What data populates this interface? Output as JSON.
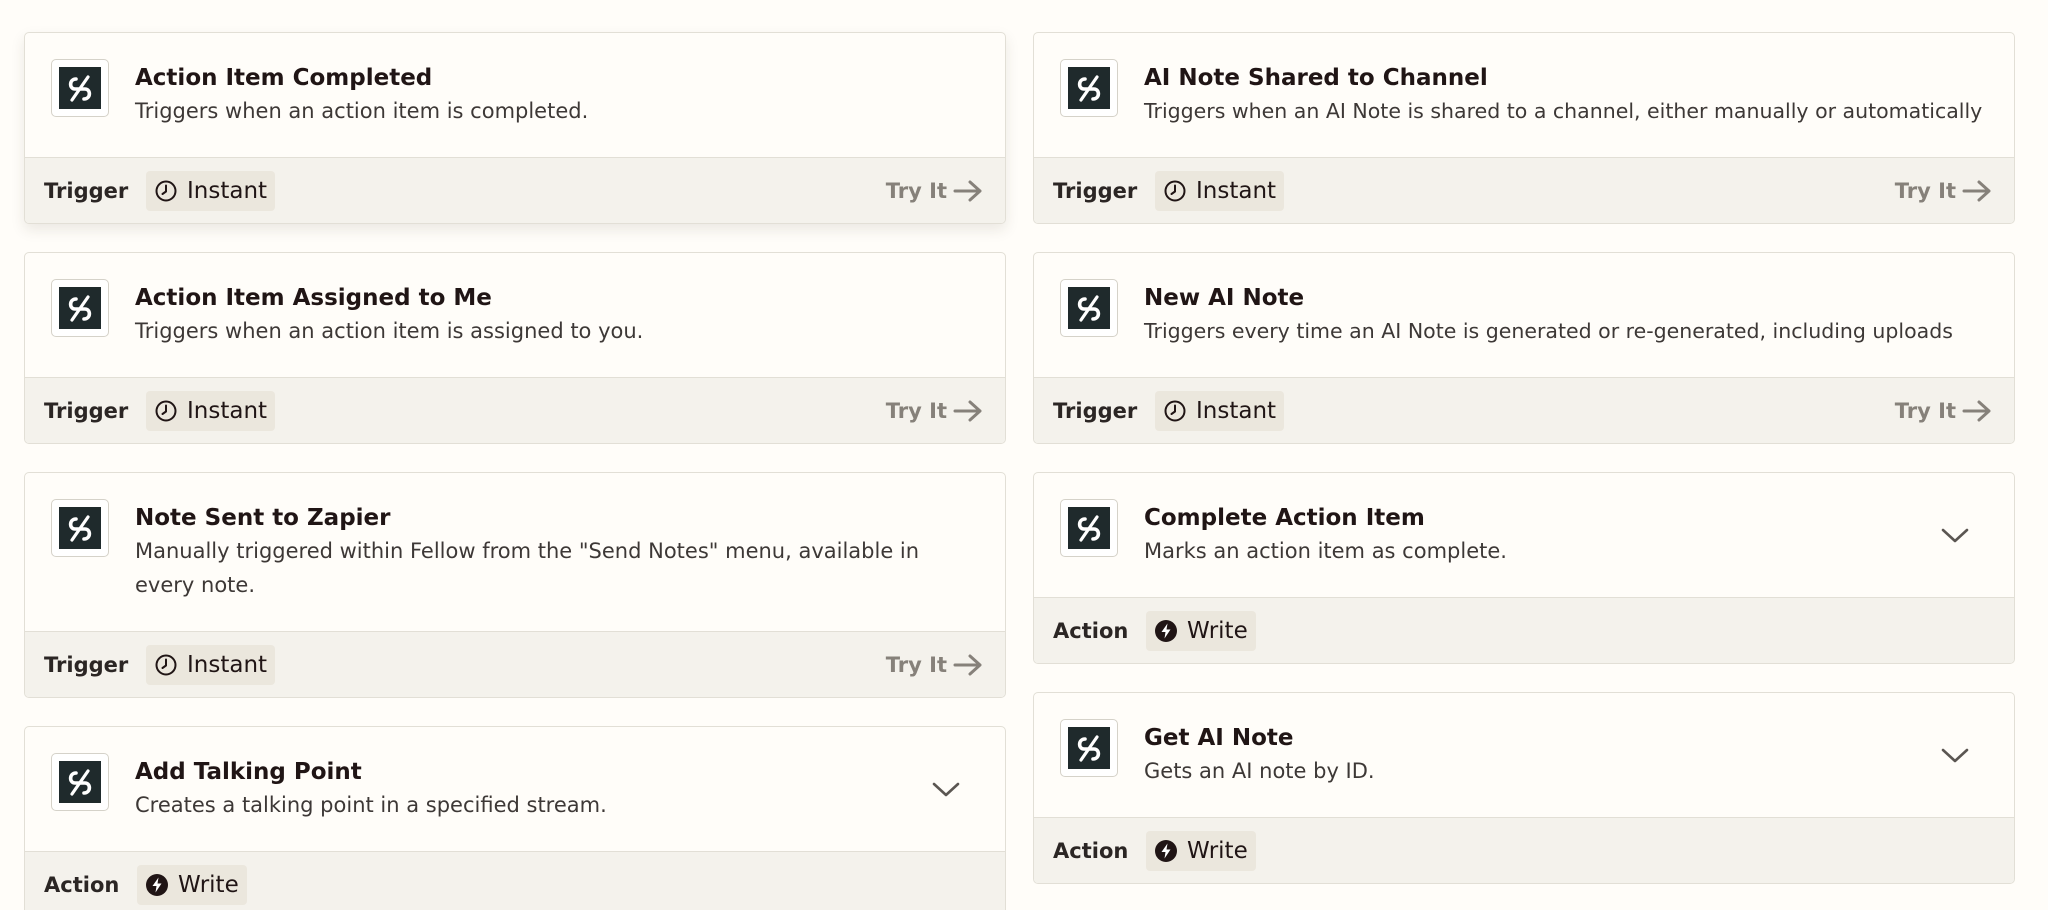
{
  "labels": {
    "trigger": "Trigger",
    "action": "Action",
    "instant": "Instant",
    "write": "Write",
    "try_it": "Try It"
  },
  "icons": {
    "app_logo": "fellow-logo-icon",
    "instant_badge": "clock-icon",
    "write_badge": "lightning-bolt-icon",
    "try_it": "arrow-right-icon",
    "expand": "chevron-down-icon"
  },
  "colors": {
    "logo_background": "#1f2a2c",
    "card_footer": "#f4f2ec",
    "badge_background": "#ebe7dd",
    "try_it_text": "#86817a"
  },
  "left_column": [
    {
      "title": "Action Item Completed",
      "description": "Triggers when an action item is completed."
    },
    {
      "title": "Action Item Assigned to Me",
      "description": "Triggers when an action item is assigned to you."
    },
    {
      "title": "Note Sent to Zapier",
      "description": "Manually triggered within Fellow from the \"Send Notes\" menu, available in every note."
    },
    {
      "title": "Add Talking Point",
      "description": "Creates a talking point in a specified stream."
    }
  ],
  "right_column": [
    {
      "title": "AI Note Shared to Channel",
      "description": "Triggers when an AI Note is shared to a channel, either manually or automatically"
    },
    {
      "title": "New AI Note",
      "description": "Triggers every time an AI Note is generated or re-generated, including uploads"
    },
    {
      "title": "Complete Action Item",
      "description": "Marks an action item as complete."
    },
    {
      "title": "Get AI Note",
      "description": "Gets an AI note by ID."
    }
  ]
}
